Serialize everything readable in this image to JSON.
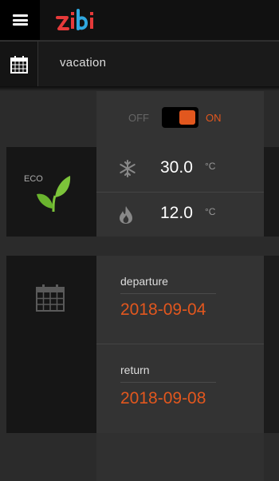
{
  "app": {
    "logo_text": "zibi"
  },
  "header": {
    "title": "vacation"
  },
  "toggle": {
    "off_label": "OFF",
    "on_label": "ON",
    "state": "on"
  },
  "eco": {
    "label": "ECO",
    "cooling": {
      "value": "30.0",
      "unit": "°C"
    },
    "heating": {
      "value": "12.0",
      "unit": "°C"
    }
  },
  "dates": {
    "departure": {
      "label": "departure",
      "value": "2018-09-04"
    },
    "return": {
      "label": "return",
      "value": "2018-09-08"
    }
  },
  "colors": {
    "accent": "#e2571e",
    "eco_green": "#7cc43a"
  }
}
